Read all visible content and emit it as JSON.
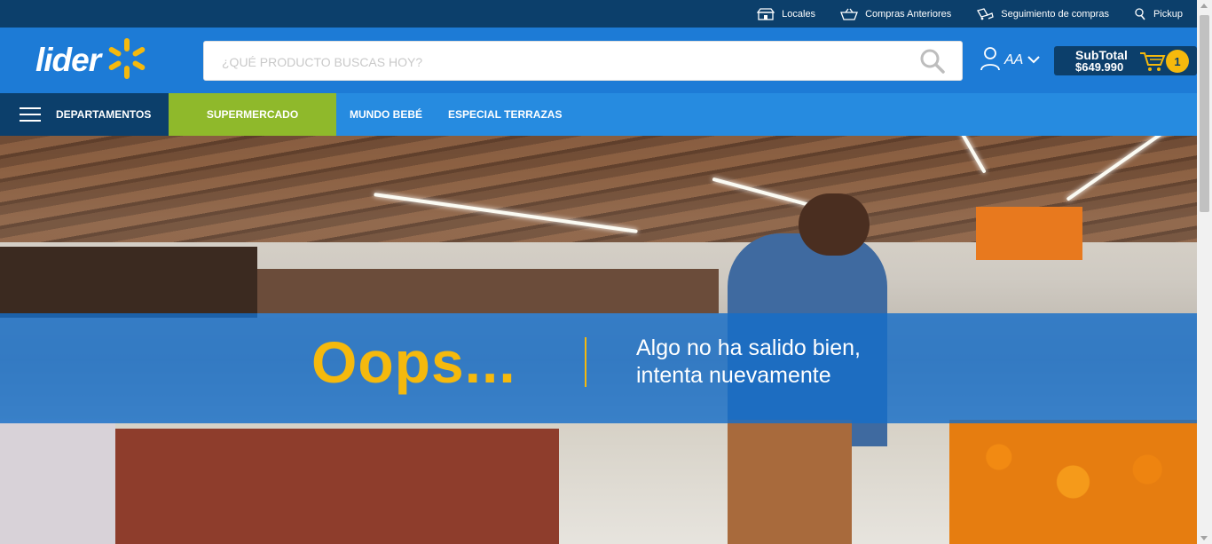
{
  "topbar": {
    "links": [
      {
        "label": "Locales",
        "icon": "store-icon"
      },
      {
        "label": "Compras Anteriores",
        "icon": "basket-icon"
      },
      {
        "label": "Seguimiento de compras",
        "icon": "truck-icon"
      },
      {
        "label": "Pickup",
        "icon": "pickup-icon"
      }
    ]
  },
  "header": {
    "logo_text": "lider",
    "search_placeholder": "¿QUÉ PRODUCTO BUSCAS HOY?",
    "account_initials": "AA",
    "cart": {
      "label": "SubTotal",
      "amount": "$649.990",
      "count": "1"
    }
  },
  "nav": {
    "departments_label": "DEPARTAMENTOS",
    "items": [
      "SUPERMERCADO",
      "MUNDO BEBÉ",
      "ESPECIAL TERRAZAS"
    ]
  },
  "error": {
    "title": "Oops...",
    "message_line1": "Algo no ha salido bien,",
    "message_line2": "intenta nuevamente"
  },
  "colors": {
    "brand_blue": "#1d7bd6",
    "dark_blue": "#0c3f6b",
    "accent_yellow": "#f5b90d",
    "supermercado_green": "#8fb92b"
  }
}
